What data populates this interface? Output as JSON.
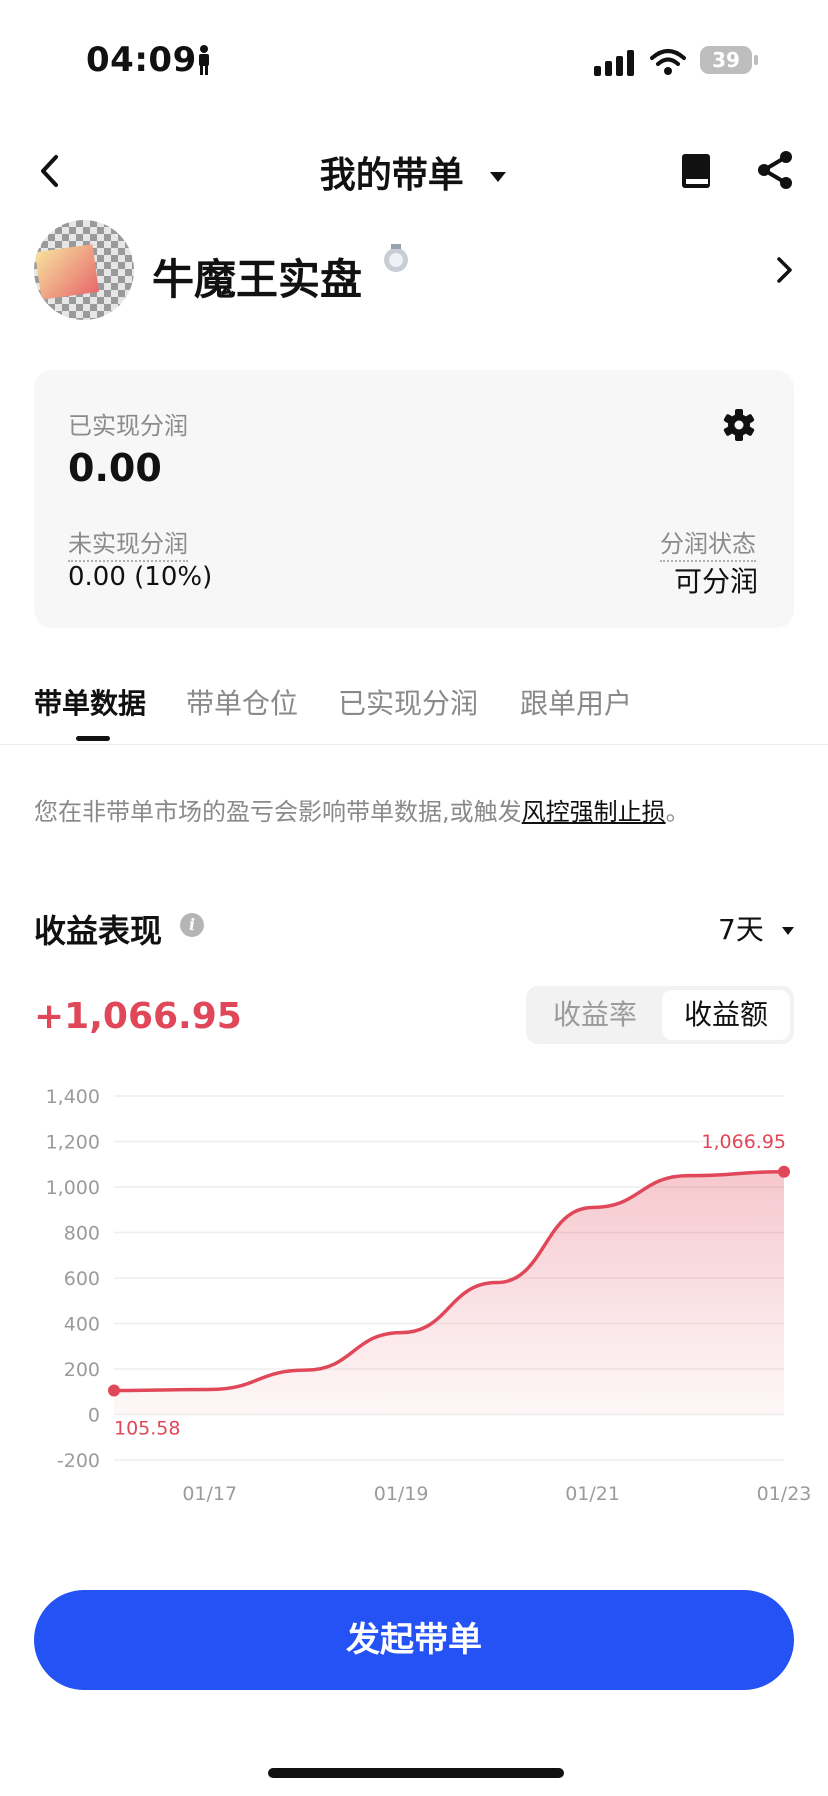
{
  "status_bar": {
    "time": "04:09",
    "battery": "39"
  },
  "nav": {
    "title": "我的带单"
  },
  "profile": {
    "name": "牛魔王实盘"
  },
  "card": {
    "realized_label": "已实现分润",
    "realized_value": "0.00",
    "unrealized_label": "未实现分润",
    "unrealized_value": "0.00 (10%)",
    "status_label": "分润状态",
    "status_value": "可分润"
  },
  "tabs": [
    {
      "label": "带单数据"
    },
    {
      "label": "带单仓位"
    },
    {
      "label": "已实现分润"
    },
    {
      "label": "跟单用户"
    }
  ],
  "notice": {
    "text": "您在非带单市场的盈亏会影响带单数据,或触发",
    "link": "风控强制止损",
    "suffix": "。"
  },
  "performance": {
    "title": "收益表现",
    "period": "7天",
    "total": "+1,066.95",
    "toggle": {
      "rate_label": "收益率",
      "amount_label": "收益额",
      "selected": "收益额"
    }
  },
  "chart_data": {
    "type": "area",
    "x": [
      "01/16",
      "01/17",
      "01/18",
      "01/19",
      "01/20",
      "01/21",
      "01/22",
      "01/23"
    ],
    "y": [
      105.58,
      110,
      195,
      360,
      580,
      910,
      1050,
      1066.95
    ],
    "xticks": [
      "01/17",
      "01/19",
      "01/21",
      "01/23"
    ],
    "yticks": [
      "1,400",
      "1,200",
      "1,000",
      "800",
      "600",
      "400",
      "200",
      "0",
      "-200"
    ],
    "ylim": [
      -200,
      1400
    ],
    "start_label": "105.58",
    "end_label": "1,066.95",
    "color": "#e0485a",
    "grid": true
  },
  "cta": {
    "label": "发起带单"
  },
  "colors": {
    "accent": "#2452f5",
    "profit": "#e0485a"
  }
}
